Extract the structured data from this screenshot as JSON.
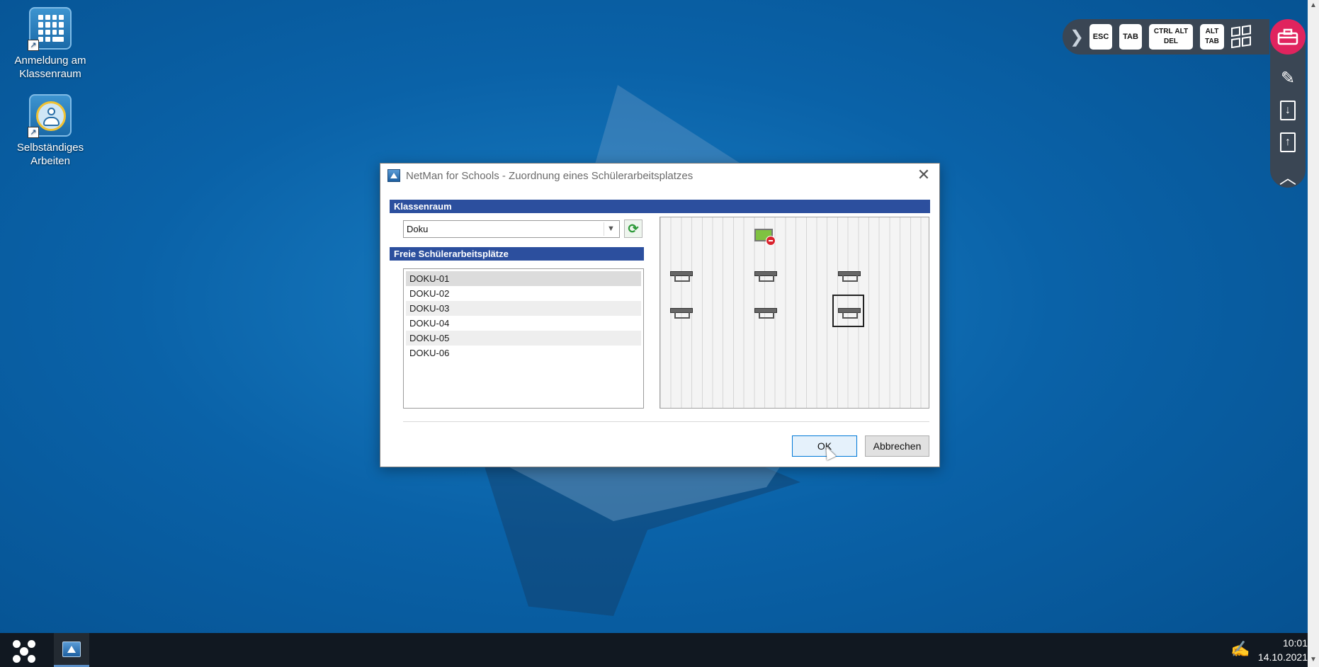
{
  "desktop": {
    "icons": [
      {
        "label_line1": "Anmeldung am",
        "label_line2": "Klassenraum",
        "icon": "keypad-icon"
      },
      {
        "label_line1": "Selbständiges",
        "label_line2": "Arbeiten",
        "icon": "person-icon"
      }
    ]
  },
  "remote_toolbar": {
    "expand": "❯",
    "keys": {
      "esc": "ESC",
      "tab": "TAB",
      "ctrl": "CTRL",
      "alt": "ALT",
      "del": "DEL",
      "alt2": "ALT",
      "tab2": "TAB"
    },
    "side_icons": [
      "toolbox-icon",
      "disconnect-icon",
      "download-file-icon",
      "upload-file-icon",
      "collapse-icon"
    ],
    "accent_color": "#e0245e"
  },
  "dialog": {
    "title": "NetMan for Schools - Zuordnung eines Schülerarbeitsplatzes",
    "close": "✕",
    "section_classroom": "Klassenraum",
    "classroom_value": "Doku",
    "section_free": "Freie Schülerarbeitsplätze",
    "free_workstations": [
      "DOKU-01",
      "DOKU-02",
      "DOKU-03",
      "DOKU-04",
      "DOKU-05",
      "DOKU-06"
    ],
    "ok_label": "OK",
    "cancel_label": "Abbrechen",
    "header_color": "#2c4f9e"
  },
  "taskbar": {
    "time": "10:01",
    "date": "14.10.2021"
  }
}
